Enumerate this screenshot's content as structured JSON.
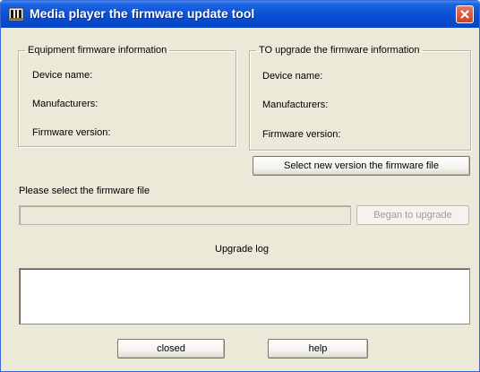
{
  "window": {
    "title": "Media player the firmware update tool",
    "icon": "media-player-app-icon",
    "close_icon": "close-icon"
  },
  "equipment_info": {
    "legend": "Equipment firmware information",
    "device_name_label": "Device name:",
    "manufacturers_label": "Manufacturers:",
    "firmware_version_label": "Firmware version:"
  },
  "upgrade_info": {
    "legend": "TO upgrade the firmware information",
    "device_name_label": "Device name:",
    "manufacturers_label": "Manufacturers:",
    "firmware_version_label": "Firmware version:"
  },
  "select_file_button": "Select new version the firmware file",
  "file_prompt": "Please select the firmware file",
  "file_path_value": "",
  "upgrade_button": "Began to upgrade",
  "log_label": "Upgrade log",
  "log_text": "",
  "close_button": "closed",
  "help_button": "help",
  "colors": {
    "titlebar": "#0a4fd4",
    "dialog_face": "#ece9d8",
    "close_button": "#c94120"
  }
}
